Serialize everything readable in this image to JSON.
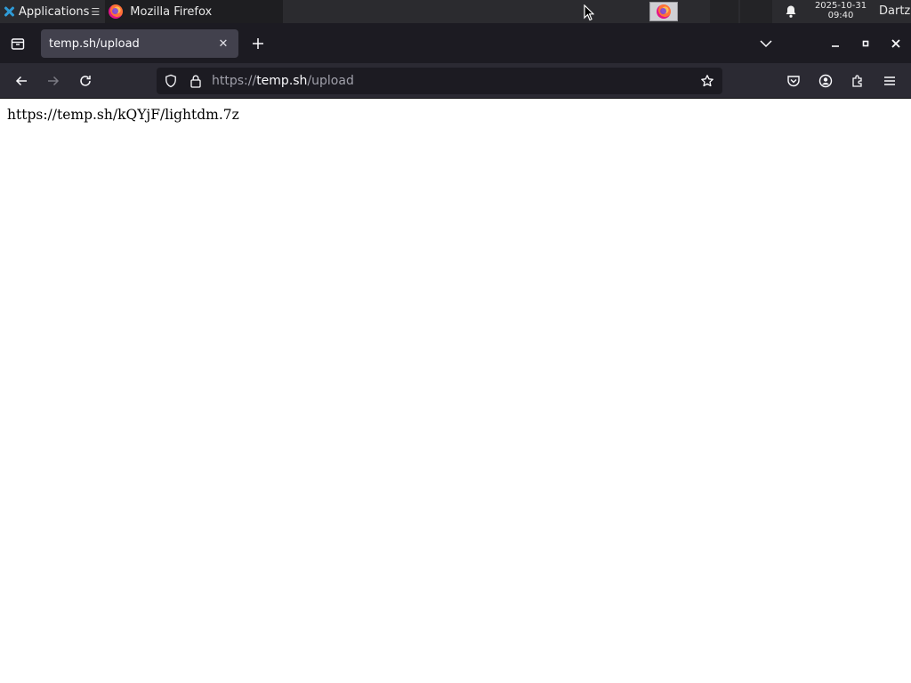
{
  "desktop_panel": {
    "applications_label": "Applications",
    "taskbar_window_title": "Mozilla Firefox",
    "clock_date": "2025-10-31",
    "clock_time": "09:40",
    "user_name": "Dartz"
  },
  "browser": {
    "tab_title": "temp.sh/upload",
    "url_scheme": "https://",
    "url_host": "temp.sh",
    "url_path": "/upload"
  },
  "page": {
    "body_text": "https://temp.sh/kQYjF/lightdm.7z"
  },
  "icons": {
    "desktop": [
      "applications-logo-icon",
      "firefox-icon",
      "mouse-cursor-icon",
      "bell-icon"
    ],
    "browser": [
      "firefox-view-icon",
      "close-icon",
      "plus-icon",
      "chevron-down-icon",
      "minimize-icon",
      "maximize-icon",
      "close-window-icon",
      "back-arrow-icon",
      "forward-arrow-icon",
      "reload-icon",
      "shield-icon",
      "lock-icon",
      "star-icon",
      "pocket-icon",
      "account-icon",
      "extensions-icon",
      "hamburger-menu-icon"
    ]
  },
  "colors": {
    "panel_bg": "#2b2b2f",
    "tabstrip_bg": "#1c1b22",
    "active_tab_bg": "#42414d",
    "navbar_bg": "#2b2a33",
    "urlbar_bg": "#1c1b22",
    "page_bg": "#ffffff"
  }
}
